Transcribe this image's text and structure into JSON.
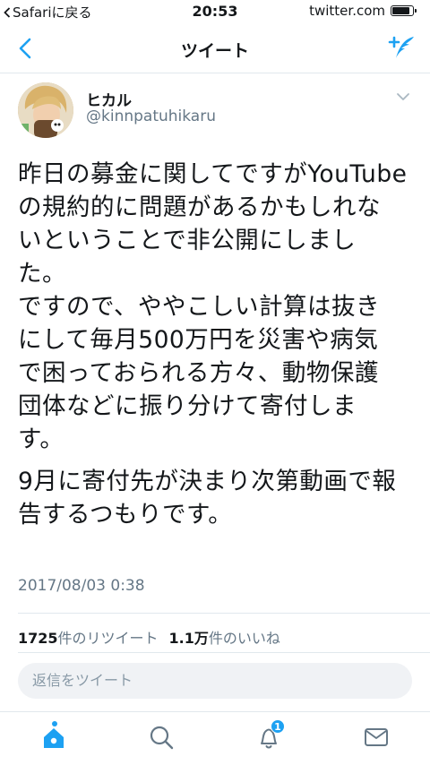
{
  "status_bar": {
    "back_label": "Safariに戻る",
    "time": "20:53",
    "url": "twitter.com",
    "battery_level": 0.9
  },
  "nav": {
    "title": "ツイート",
    "back_icon": "chevron-left-icon",
    "compose_icon": "compose-tweet-icon"
  },
  "tweet": {
    "author_name": "ヒカル",
    "author_handle": "@kinnpatuhikaru",
    "paragraphs": [
      {
        "lines": [
          "昨日の募金に関してですがYouTube",
          "の規約的に問題があるかもしれな",
          "いということで非公開にしまし",
          "た。"
        ]
      },
      {
        "lines": [
          "ですので、ややこしい計算は抜き",
          "にして毎月500万円を災害や病気",
          "で困っておられる方々、動物保護",
          "団体などに振り分けて寄付しま",
          "す。"
        ]
      },
      {
        "lines": [
          "9月に寄付先が決まり次第動画で報",
          "告するつもりです。"
        ]
      }
    ],
    "timestamp": "2017/08/03 0:38",
    "retweet_count": "1725",
    "retweet_label": "件のリツイート",
    "like_count": "1.1万",
    "like_label": "件のいいね"
  },
  "reply": {
    "placeholder": "返信をツイート"
  },
  "tab_bar": {
    "notification_badge": "1",
    "accent_color": "#1da1f2"
  }
}
